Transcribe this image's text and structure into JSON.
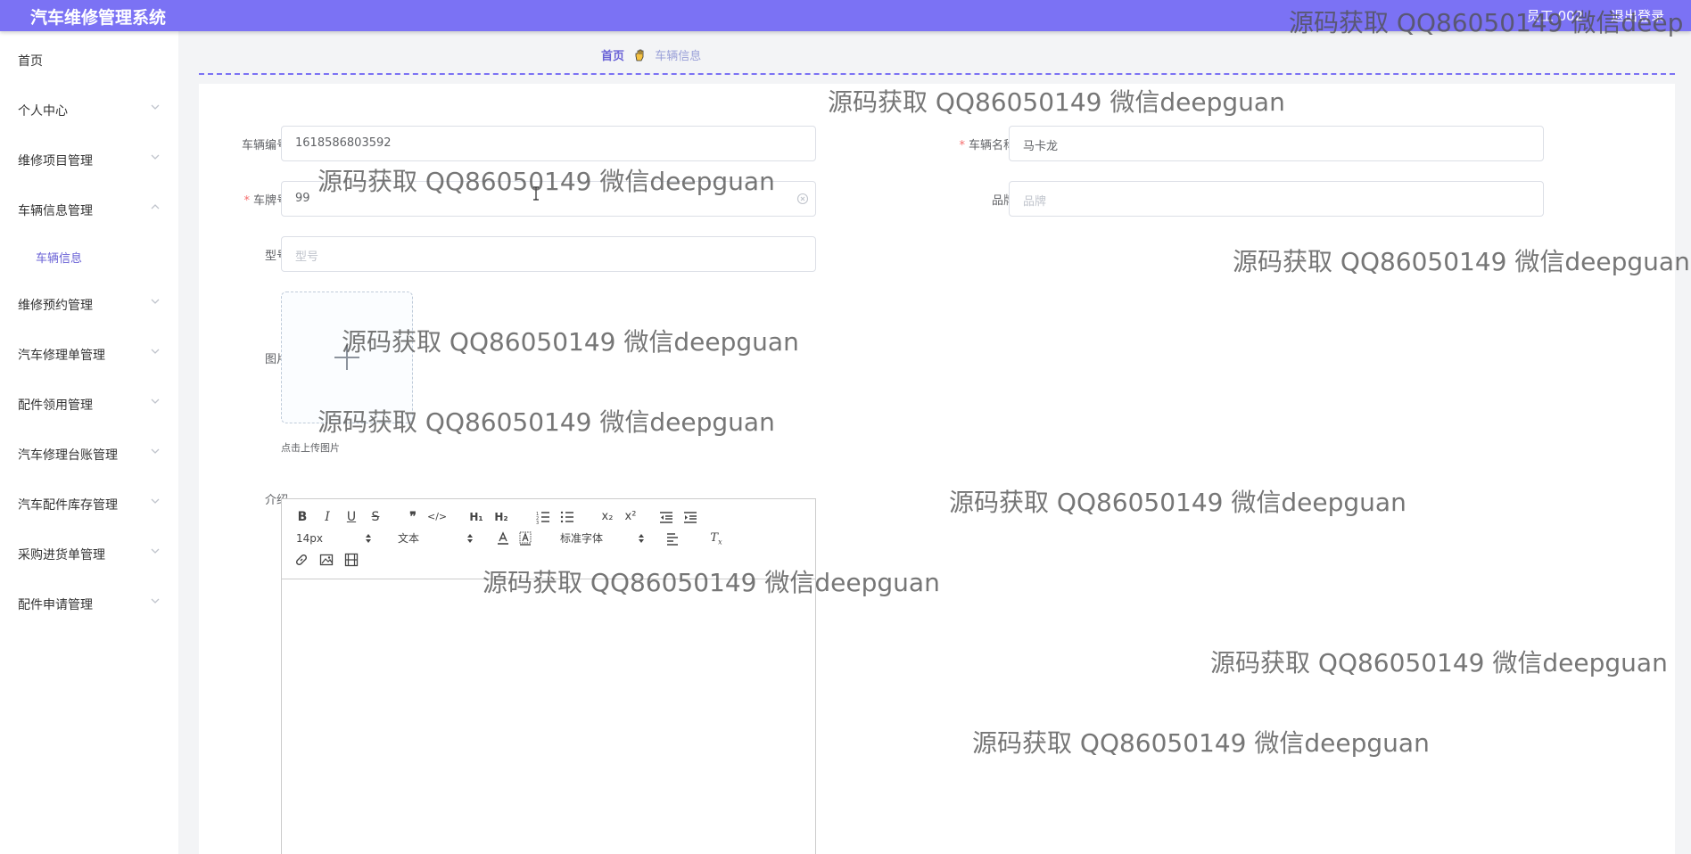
{
  "header": {
    "app_title": "汽车维修管理系统",
    "user_label": "员工 002",
    "logout_label": "退出登录"
  },
  "sidebar": {
    "items": [
      {
        "label": "首页"
      },
      {
        "label": "个人中心"
      },
      {
        "label": "维修项目管理"
      },
      {
        "label": "车辆信息管理"
      },
      {
        "label": "车辆信息"
      },
      {
        "label": "维修预约管理"
      },
      {
        "label": "汽车修理单管理"
      },
      {
        "label": "配件领用管理"
      },
      {
        "label": "汽车修理台账管理"
      },
      {
        "label": "汽车配件库存管理"
      },
      {
        "label": "采购进货单管理"
      },
      {
        "label": "配件申请管理"
      }
    ]
  },
  "breadcrumb": {
    "home": "首页",
    "current": "车辆信息"
  },
  "form": {
    "vehicle_no": {
      "label": "车辆编号",
      "value": "1618586803592"
    },
    "vehicle_name": {
      "label": "车辆名称",
      "value": "马卡龙"
    },
    "plate_no": {
      "label": "车牌号",
      "value": "99"
    },
    "brand": {
      "label": "品牌",
      "placeholder": "品牌"
    },
    "model": {
      "label": "型号",
      "placeholder": "型号"
    },
    "image": {
      "label": "图片",
      "tip": "点击上传图片"
    },
    "intro": {
      "label": "介绍"
    }
  },
  "editor": {
    "font_size": "14px",
    "block_format": "文本",
    "font_family": "标准字体",
    "tools": [
      "bold-icon",
      "italic-icon",
      "underline-icon",
      "strike-icon",
      "blockquote-icon",
      "code-block-icon",
      "header1-icon",
      "header2-icon",
      "ordered-list-icon",
      "bullet-list-icon",
      "subscript-icon",
      "superscript-icon",
      "outdent-icon",
      "indent-icon",
      "font-color-icon",
      "background-color-icon",
      "align-icon",
      "clear-format-icon",
      "link-icon",
      "image-icon",
      "video-icon"
    ]
  },
  "watermark": {
    "text": "源码获取 QQ86050149 微信deepguan",
    "text_top_right": "源码获取 QQ86050149 微信deep"
  },
  "colors": {
    "header": "#7b72f4",
    "accent": "#6a62d6",
    "required": "#f56c6c"
  }
}
